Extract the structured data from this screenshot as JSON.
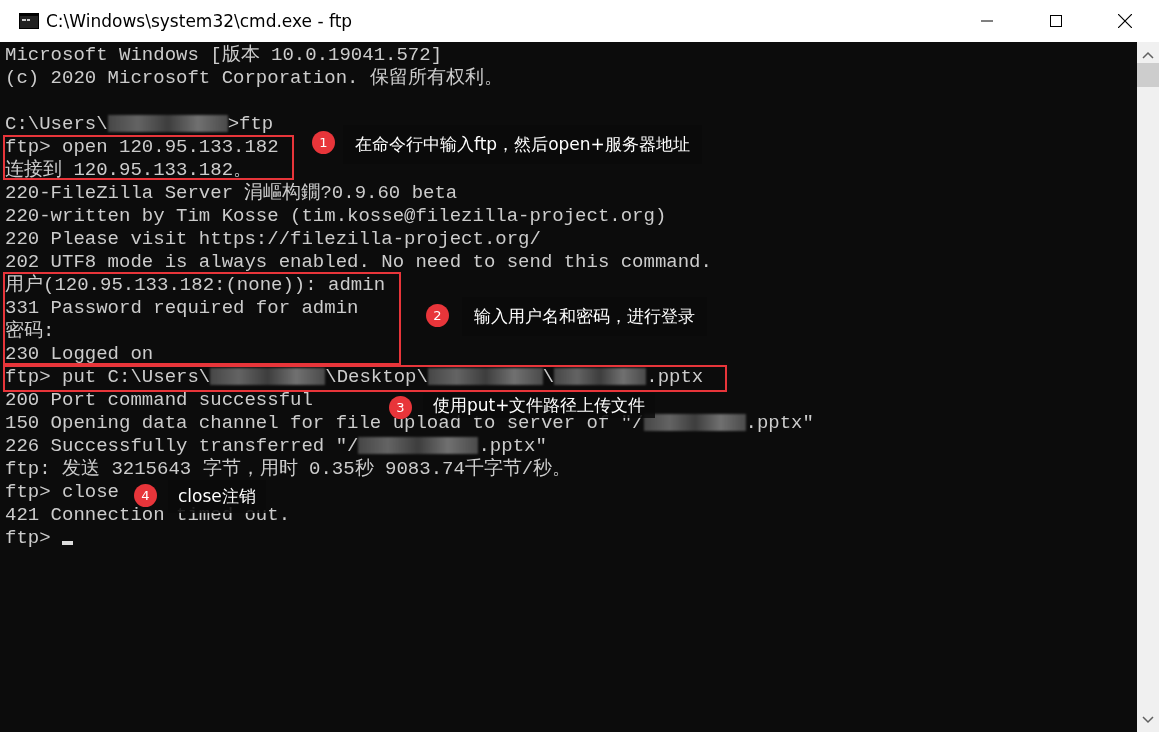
{
  "window": {
    "title": "C:\\Windows\\system32\\cmd.exe - ftp"
  },
  "console": {
    "lines": [
      {
        "kind": "output",
        "parts": [
          {
            "kind": "text",
            "text": "Microsoft Windows [版本 10.0.19041.572]"
          }
        ]
      },
      {
        "kind": "output",
        "parts": [
          {
            "kind": "text",
            "text": "(c) 2020 Microsoft Corporation. 保留所有权利。"
          }
        ]
      },
      {
        "kind": "blank"
      },
      {
        "kind": "output",
        "parts": [
          {
            "kind": "text",
            "text": "C:\\Users\\"
          },
          {
            "kind": "blur"
          },
          {
            "kind": "text",
            "text": ">ftp"
          }
        ]
      },
      {
        "kind": "output",
        "parts": [
          {
            "kind": "text",
            "text": "ftp> open 120.95.133.182"
          }
        ]
      },
      {
        "kind": "output",
        "parts": [
          {
            "kind": "text",
            "text": "连接到 120.95.133.182。"
          }
        ]
      },
      {
        "kind": "output",
        "parts": [
          {
            "kind": "text",
            "text": "220-FileZilla Server 涓嶇构鐗?0.9.60 beta"
          }
        ]
      },
      {
        "kind": "output",
        "parts": [
          {
            "kind": "text",
            "text": "220-written by Tim Kosse (tim.kosse@filezilla-project.org)"
          }
        ]
      },
      {
        "kind": "output",
        "parts": [
          {
            "kind": "text",
            "text": "220 Please visit https://filezilla-project.org/"
          }
        ]
      },
      {
        "kind": "output",
        "parts": [
          {
            "kind": "text",
            "text": "202 UTF8 mode is always enabled. No need to send this command."
          }
        ]
      },
      {
        "kind": "output",
        "parts": [
          {
            "kind": "text",
            "text": "用户(120.95.133.182:(none)): admin"
          }
        ]
      },
      {
        "kind": "output",
        "parts": [
          {
            "kind": "text",
            "text": "331 Password required for admin"
          }
        ]
      },
      {
        "kind": "output",
        "parts": [
          {
            "kind": "text",
            "text": "密码:"
          }
        ]
      },
      {
        "kind": "output",
        "parts": [
          {
            "kind": "text",
            "text": "230 Logged on"
          }
        ]
      },
      {
        "kind": "output",
        "parts": [
          {
            "kind": "text",
            "text": "ftp> put C:\\Users\\"
          },
          {
            "kind": "blur"
          },
          {
            "kind": "text",
            "text": "\\Desktop\\"
          },
          {
            "kind": "blur"
          },
          {
            "kind": "text",
            "text": "\\"
          },
          {
            "kind": "blur"
          },
          {
            "kind": "text",
            "text": ".pptx"
          }
        ]
      },
      {
        "kind": "output",
        "parts": [
          {
            "kind": "text",
            "text": "200 Port command successful"
          }
        ]
      },
      {
        "kind": "output",
        "parts": [
          {
            "kind": "text",
            "text": "150 Opening data channel for file upload to server of \"/"
          },
          {
            "kind": "blur"
          },
          {
            "kind": "text",
            "text": ".pptx\""
          }
        ]
      },
      {
        "kind": "output",
        "parts": [
          {
            "kind": "text",
            "text": "226 Successfully transferred \"/"
          },
          {
            "kind": "blur"
          },
          {
            "kind": "text",
            "text": ".pptx\""
          }
        ]
      },
      {
        "kind": "output",
        "parts": [
          {
            "kind": "text",
            "text": "ftp: 发送 3215643 字节，用时 0.35秒 9083.74千字节/秒。"
          }
        ]
      },
      {
        "kind": "output",
        "parts": [
          {
            "kind": "text",
            "text": "ftp> close"
          }
        ]
      },
      {
        "kind": "output",
        "parts": [
          {
            "kind": "text",
            "text": "421 Connection timed out."
          }
        ]
      },
      {
        "kind": "output",
        "parts": [
          {
            "kind": "text",
            "text": "ftp> "
          },
          {
            "kind": "cursor"
          }
        ]
      }
    ]
  },
  "annotations": [
    {
      "number": "1",
      "text": "在命令行中输入ftp，然后open+服务器地址"
    },
    {
      "number": "2",
      "text": "输入用户名和密码，进行登录"
    },
    {
      "number": "3",
      "text": "使用put+文件路径上传文件"
    },
    {
      "number": "4",
      "text": "close注销"
    }
  ]
}
